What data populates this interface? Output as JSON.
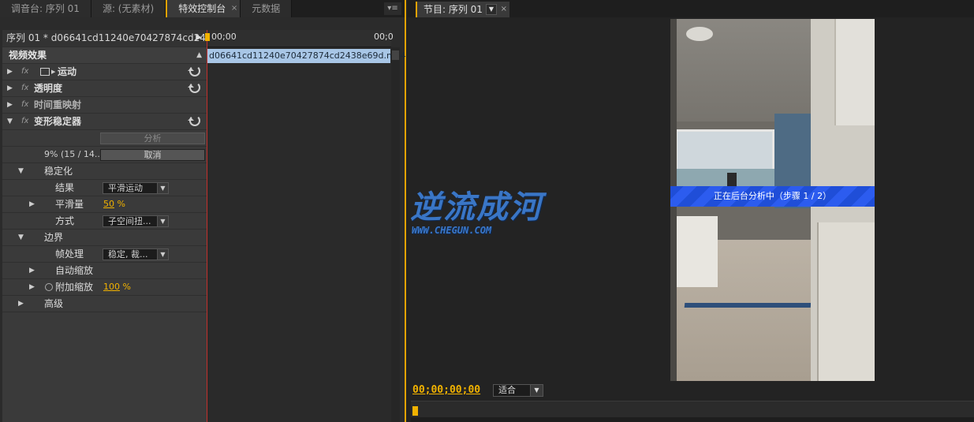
{
  "left_tabs": [
    {
      "label": "调音台: 序列 01"
    },
    {
      "label": "源: (无素材)"
    },
    {
      "label": "特效控制台"
    },
    {
      "label": "元数据"
    }
  ],
  "effect_controls": {
    "sequence_header": "序列 01 * d06641cd11240e70427874cd2438...",
    "video_effects_label": "视频效果",
    "effects": [
      {
        "name": "运动"
      },
      {
        "name": "透明度"
      },
      {
        "name": "时间重映射"
      },
      {
        "name": "变形稳定器"
      }
    ],
    "analyze_button": "分析",
    "progress_text": "9% (15 / 14...",
    "cancel_button": "取消",
    "stabilization_group": "稳定化",
    "result_label": "结果",
    "result_value": "平滑运动",
    "smoothness_label": "平滑量",
    "smoothness_value": "50",
    "smoothness_unit": "%",
    "method_label": "方式",
    "method_value": "子空间扭...",
    "borders_group": "边界",
    "framing_label": "帧处理",
    "framing_value": "稳定, 裁...",
    "autoscale_label": "自动缩放",
    "extra_scale_label": "附加缩放",
    "extra_scale_value": "100",
    "extra_scale_unit": "%",
    "advanced_group": "高级"
  },
  "mini_timeline": {
    "start_time": "00;00",
    "end_time": "00;0",
    "clip_name": "d06641cd11240e70427874cd2438e69d.mp4"
  },
  "program_monitor": {
    "tab_label": "节目: 序列 01",
    "analysis_banner": "正在后台分析中（步骤 1 / 2）",
    "timecode": "00;00;00;00",
    "fit_value": "适合"
  },
  "watermark": {
    "title": "逆流成河",
    "url": "WWW.CHEGUN.COM"
  },
  "colors": {
    "accent": "#e8a300",
    "value": "#f1b200",
    "banner": "#2358e0",
    "clip": "#a8c6e6"
  }
}
